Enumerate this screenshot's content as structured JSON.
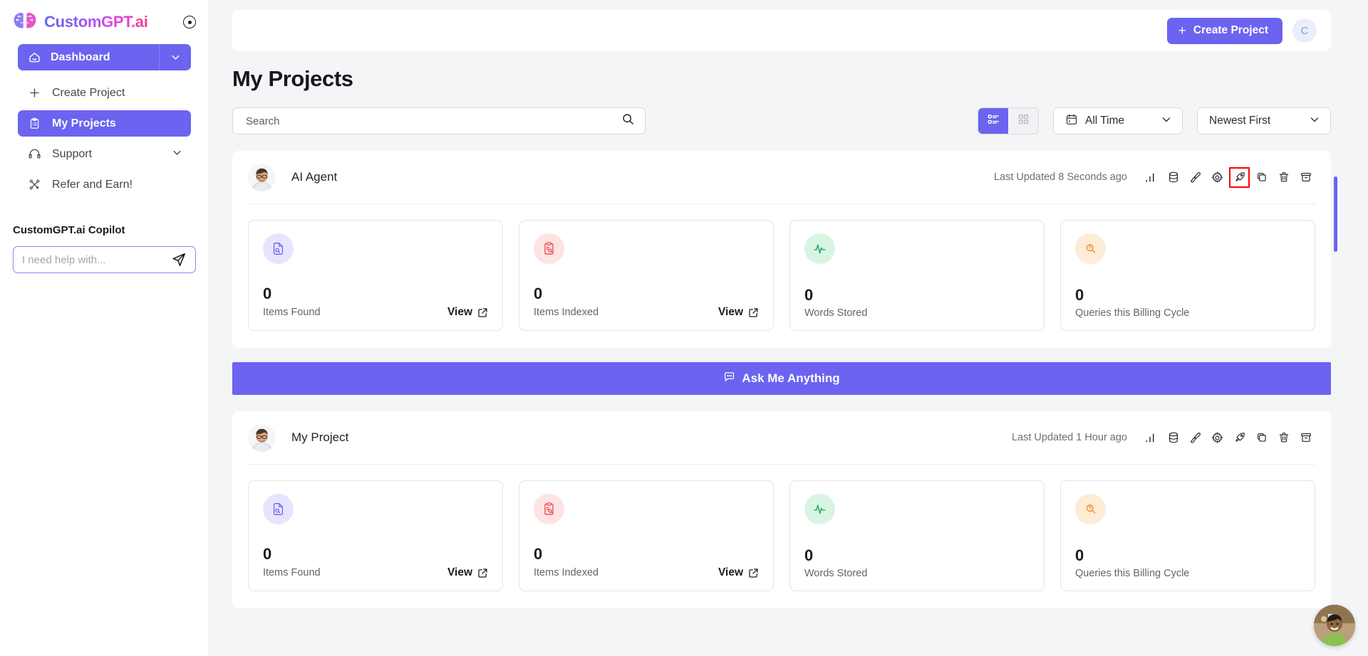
{
  "brand": {
    "name": "CustomGPT.ai",
    "accent": "#6c63f0",
    "record_icon": "record-dot-icon",
    "logo_icon": "brain-icon"
  },
  "sidebar": {
    "dashboard": {
      "label": "Dashboard",
      "icon": "home-icon",
      "caret": "chevron-down-icon"
    },
    "items": [
      {
        "label": "Create Project",
        "icon": "plus-icon",
        "active": false
      },
      {
        "label": "My Projects",
        "icon": "clipboard-icon",
        "active": true
      },
      {
        "label": "Support",
        "icon": "headset-icon",
        "active": false,
        "caret": "chevron-down-icon"
      },
      {
        "label": "Refer and Earn!",
        "icon": "share-nodes-icon",
        "active": false
      }
    ],
    "copilot": {
      "title": "CustomGPT.ai Copilot",
      "placeholder": "I need help with...",
      "value": "",
      "send_icon": "send-icon"
    }
  },
  "topbar": {
    "create_project_label": "Create Project",
    "create_project_icon": "plus-icon",
    "avatar_initial": "C"
  },
  "page": {
    "title": "My Projects"
  },
  "search": {
    "placeholder": "Search",
    "value": "",
    "icon": "search-icon"
  },
  "view_toggle": {
    "list_icon": "list-view-icon",
    "grid_icon": "grid-view-icon",
    "selected": "list"
  },
  "filters": {
    "time": {
      "label": "All Time",
      "icon": "calendar-icon",
      "caret": "chevron-down-icon"
    },
    "sort": {
      "label": "Newest First",
      "caret": "chevron-down-icon"
    }
  },
  "row_action_icons": [
    "bar-chart-icon",
    "database-icon",
    "paintbrush-icon",
    "gear-icon",
    "rocket-icon",
    "copy-icon",
    "trash-icon",
    "archive-icon"
  ],
  "annotation": {
    "highlight_icon": "rocket-icon",
    "highlight_color": "#ff0000",
    "arrow": "up-arrow-annotation"
  },
  "banner": {
    "label": "Ask Me Anything",
    "icon": "chat-bubble-icon"
  },
  "projects": [
    {
      "name": "AI Agent",
      "avatar": "user-avatar",
      "last_updated": "Last Updated 8 Seconds ago",
      "highlighted_action": "rocket-icon",
      "stats": [
        {
          "value": "0",
          "label": "Items Found",
          "action": "View",
          "icon": "document-search-icon",
          "icon_color": "#6c63f0",
          "icon_bg": "#e7e5fd"
        },
        {
          "value": "0",
          "label": "Items Indexed",
          "action": "View",
          "icon": "clipboard-search-icon",
          "icon_color": "#f04444",
          "icon_bg": "#fde3e3"
        },
        {
          "value": "0",
          "label": "Words Stored",
          "action": "",
          "icon": "activity-pulse-icon",
          "icon_color": "#27ae60",
          "icon_bg": "#d8f5e4"
        },
        {
          "value": "0",
          "label": "Queries this Billing Cycle",
          "action": "",
          "icon": "query-search-icon",
          "icon_color": "#f08b24",
          "icon_bg": "#fdecd6"
        }
      ],
      "has_banner": true
    },
    {
      "name": "My Project",
      "avatar": "user-avatar",
      "last_updated": "Last Updated 1 Hour ago",
      "highlighted_action": "",
      "stats": [
        {
          "value": "0",
          "label": "Items Found",
          "action": "View",
          "icon": "document-search-icon",
          "icon_color": "#6c63f0",
          "icon_bg": "#e7e5fd"
        },
        {
          "value": "0",
          "label": "Items Indexed",
          "action": "View",
          "icon": "clipboard-search-icon",
          "icon_color": "#f04444",
          "icon_bg": "#fde3e3"
        },
        {
          "value": "0",
          "label": "Words Stored",
          "action": "",
          "icon": "activity-pulse-icon",
          "icon_color": "#27ae60",
          "icon_bg": "#d8f5e4"
        },
        {
          "value": "0",
          "label": "Queries this Billing Cycle",
          "action": "",
          "icon": "query-search-icon",
          "icon_color": "#f08b24",
          "icon_bg": "#fdecd6"
        }
      ],
      "has_banner": false
    }
  ],
  "chat_widget": {
    "icon": "support-agent-avatar"
  }
}
